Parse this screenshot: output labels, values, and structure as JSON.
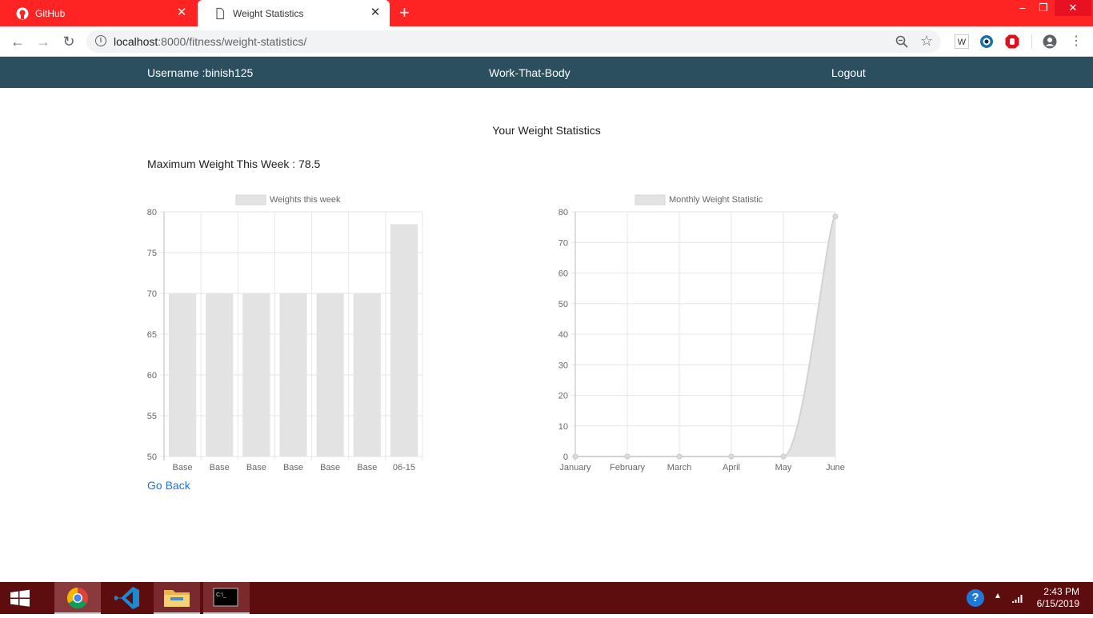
{
  "browser": {
    "tabs": [
      {
        "label": "GitHub",
        "icon": "github-icon"
      },
      {
        "label": "Weight Statistics",
        "icon": "document-icon"
      }
    ],
    "url_host": "localhost",
    "url_path": ":8000/fitness/weight-statistics/"
  },
  "nav": {
    "username": "Username :binish125",
    "brand": "Work-That-Body",
    "logout": "Logout"
  },
  "page": {
    "heading": "Your Weight Statistics",
    "max_weight": "Maximum Weight This Week : 78.5",
    "go_back": "Go Back"
  },
  "chart_data": [
    {
      "type": "bar",
      "legend": "Weights this week",
      "categories": [
        "Base",
        "Base",
        "Base",
        "Base",
        "Base",
        "Base",
        "06-15"
      ],
      "values": [
        70,
        70,
        70,
        70,
        70,
        70,
        78.5
      ],
      "ylim": [
        50,
        80
      ],
      "yticks": [
        80,
        75,
        70,
        65,
        60,
        55,
        50
      ],
      "grid": true,
      "legend_position": "top",
      "color": "#e3e3e3"
    },
    {
      "type": "area",
      "legend": "Monthly Weight Statistic",
      "categories": [
        "January",
        "February",
        "March",
        "April",
        "May",
        "June"
      ],
      "values": [
        0,
        0,
        0,
        0,
        0,
        78.5
      ],
      "ylim": [
        0,
        80
      ],
      "yticks": [
        80,
        70,
        60,
        50,
        40,
        30,
        20,
        10,
        0
      ],
      "grid": true,
      "legend_position": "top",
      "color": "#e3e3e3"
    }
  ],
  "taskbar": {
    "time": "2:43 PM",
    "date": "6/15/2019"
  },
  "colors": {
    "tabbar": "#ff2424",
    "nav": "#2b4f5f",
    "taskbar": "#5e0d0f",
    "link": "#1a73e8"
  }
}
